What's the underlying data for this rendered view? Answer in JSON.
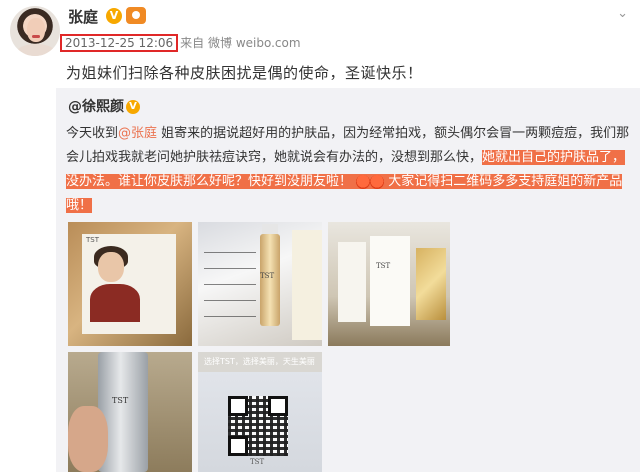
{
  "post": {
    "author": "张庭",
    "vip_mark": "V",
    "timestamp": "2013-12-25 12:06",
    "source_prefix": "来自",
    "source_name": "微博",
    "source_link": "weibo.com",
    "text": "为姐妹们扫除各种皮肤困扰是偶的使命，圣诞快乐！"
  },
  "repost": {
    "author": "@徐熙颜",
    "vip_mark": "V",
    "text_part1": "今天收到",
    "mention": "@张庭",
    "text_part2": " 姐寄来的据说超好用的护肤品，因为经常拍戏，额头偶尔会冒一两颗痘痘，我们那会儿拍戏我就老问她护肤祛痘诀窍，她就说会有办法的，没想到那么快，",
    "highlight1": "她就出自己的护肤品了，没办法。谁让你皮肤那么好呢？快好到没朋友啦！",
    "highlight2": "大家记得扫二维码多多支持庭姐的新产品哦！"
  },
  "photos": {
    "brand_text": "TST",
    "banner_text": "选择TST，选择美丽，天生美丽"
  },
  "colors": {
    "highlight_bg": "#f07047",
    "timestamp_box": "#e02828",
    "mention": "#eb7350",
    "vip": "#f7a800"
  }
}
